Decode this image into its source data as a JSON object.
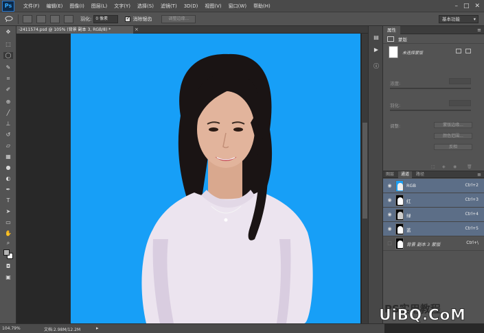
{
  "app": {
    "logo": "Ps"
  },
  "menu": [
    "文件(F)",
    "编辑(E)",
    "图像(I)",
    "图层(L)",
    "文字(Y)",
    "选择(S)",
    "滤镜(T)",
    "3D(D)",
    "视图(V)",
    "窗口(W)",
    "帮助(H)"
  ],
  "window_controls": {
    "minimize": "–",
    "maximize": "□",
    "close": "✕"
  },
  "options": {
    "feather_label": "羽化:",
    "feather_value": "0 像素",
    "antialias_label": "消除锯齿",
    "refine_edge_label": "调整边缘...",
    "workspace": "基本功能"
  },
  "document": {
    "tab_title": "-2411574.psd @ 105% (背景 副本 3, RGB/8) *",
    "close": "×",
    "background_color": "#179ff7"
  },
  "status": {
    "zoom": "104.79%",
    "doc_size": "文档:2.98M/12.2M",
    "arrow": "▸"
  },
  "properties": {
    "tab": "属性",
    "menu": "≡",
    "mask_type": "蒙版",
    "mask_status": "未选择蒙版",
    "density_label": "浓度:",
    "feather_label": "羽化:",
    "refine_label": "调整:",
    "btn_mask_edge": "蒙版边缘...",
    "btn_color_range": "颜色范围...",
    "btn_invert": "反相"
  },
  "channels": {
    "tabs": [
      "图层",
      "通道",
      "路径"
    ],
    "active_tab": "通道",
    "menu": "≡",
    "rows": [
      {
        "name": "RGB",
        "shortcut": "Ctrl+2"
      },
      {
        "name": "红",
        "shortcut": "Ctrl+3"
      },
      {
        "name": "绿",
        "shortcut": "Ctrl+4"
      },
      {
        "name": "蓝",
        "shortcut": "Ctrl+5"
      },
      {
        "name": "背景 副本 3 蒙版",
        "shortcut": "Ctrl+\\"
      }
    ]
  },
  "watermark": {
    "text": "PS实用教程",
    "logo": "UiBQ.CoM"
  }
}
